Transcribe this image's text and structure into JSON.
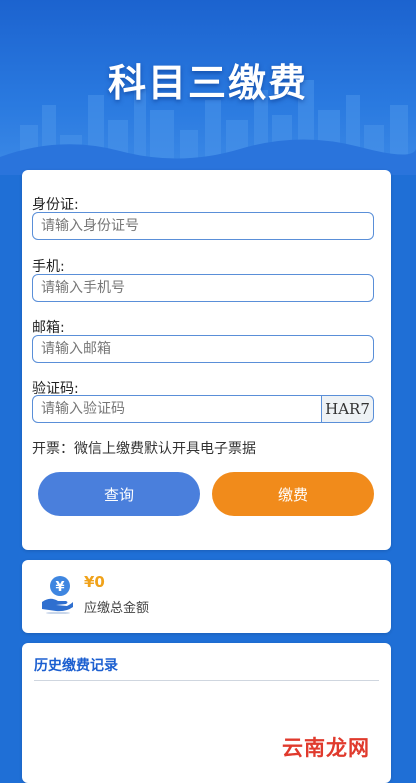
{
  "header": {
    "title": "科目三缴费"
  },
  "form": {
    "id_label": "身份证:",
    "id_placeholder": "请输入身份证号",
    "phone_label": "手机:",
    "phone_placeholder": "请输入手机号",
    "email_label": "邮箱:",
    "email_placeholder": "请输入邮箱",
    "captcha_label": "验证码:",
    "captcha_placeholder": "请输入验证码",
    "captcha_text": "HAR7",
    "invoice_note": "开票：微信上缴费默认开具电子票据",
    "query_button": "查询",
    "pay_button": "缴费"
  },
  "amount": {
    "value": "¥0",
    "label": "应缴总金额"
  },
  "history": {
    "title": "历史缴费记录"
  },
  "watermark": "云南龙网",
  "colors": {
    "primary": "#1f6fd6",
    "query_button": "#4a7fdc",
    "pay_button": "#f18b1b",
    "amount": "#f0a21a",
    "watermark": "#e03a2d"
  },
  "icons": {
    "amount_icon": "hand-coin-icon"
  }
}
